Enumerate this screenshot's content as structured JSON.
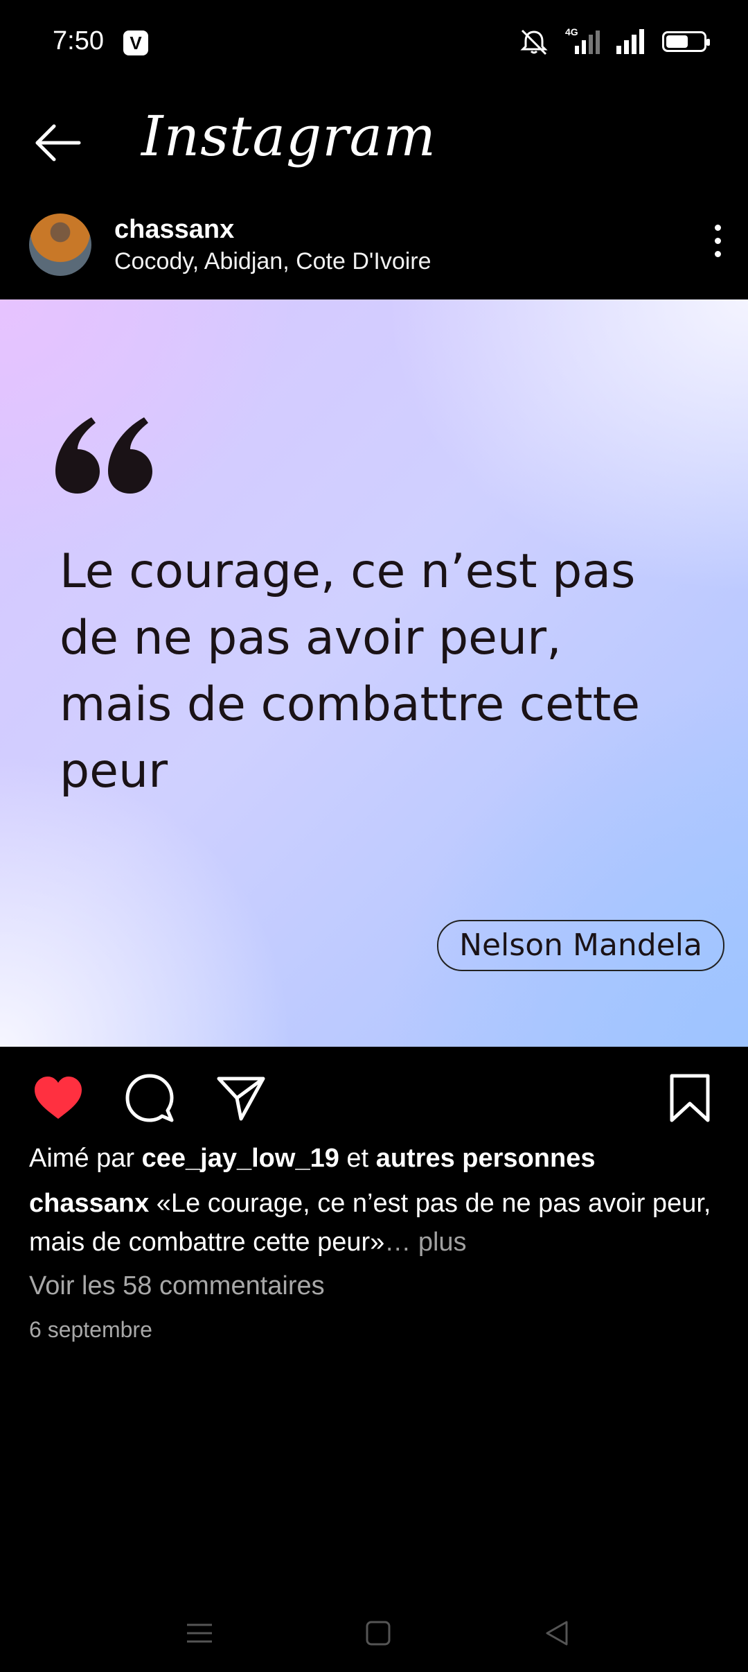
{
  "status_bar": {
    "time": "7:50",
    "app_badge": "V",
    "icons": [
      "mute-icon",
      "lte-signal-icon",
      "signal-icon",
      "battery-icon"
    ],
    "network_label": "4G",
    "battery_level_percent": 60
  },
  "header": {
    "brand": "Instagram"
  },
  "post": {
    "username": "chassanx",
    "location": "Cocody, Abidjan, Cote D'Ivoire",
    "quote": "Le courage, ce n’est pas de ne pas avoir peur, mais de combattre cette peur",
    "author": "Nelson Mandela",
    "liked": true
  },
  "caption": {
    "likes_prefix": "Aimé par",
    "likes_user": "cee_jay_low_19",
    "likes_and": "et",
    "likes_others": "autres personnes",
    "author": "chassanx",
    "text": " «Le courage, ce n’est pas de ne pas avoir peur, mais de combattre cette peur»",
    "more": "… plus",
    "comments": "Voir les 58 commentaires",
    "date": "6 septembre"
  },
  "colors": {
    "heart": "#ff3040",
    "background": "#000000",
    "quote_text": "#1a1216"
  }
}
